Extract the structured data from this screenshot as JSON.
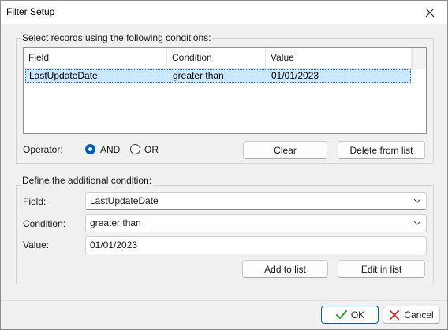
{
  "window": {
    "title": "Filter Setup"
  },
  "conditions_group": {
    "label": "Select records using the following conditions:",
    "columns": [
      "Field",
      "Condition",
      "Value"
    ],
    "rows": [
      {
        "field": "LastUpdateDate",
        "condition": "greater than",
        "value": "01/01/2023",
        "selected": true
      }
    ],
    "operator_label": "Operator:",
    "operator_and": "AND",
    "operator_or": "OR",
    "operator_selected": "AND",
    "clear_label": "Clear",
    "delete_label": "Delete from list"
  },
  "define_group": {
    "label": "Define the additional condition:",
    "field_label": "Field:",
    "field_value": "LastUpdateDate",
    "condition_label": "Condition:",
    "condition_value": "greater than",
    "value_label": "Value:",
    "value_value": "01/01/2023",
    "add_label": "Add to list",
    "edit_label": "Edit in list"
  },
  "footer": {
    "ok_label": "OK",
    "cancel_label": "Cancel"
  },
  "colors": {
    "accent": "#005fb8",
    "selection": "#cce8ff",
    "ok_check": "#3aa03a",
    "cancel_x": "#d22b2b"
  }
}
